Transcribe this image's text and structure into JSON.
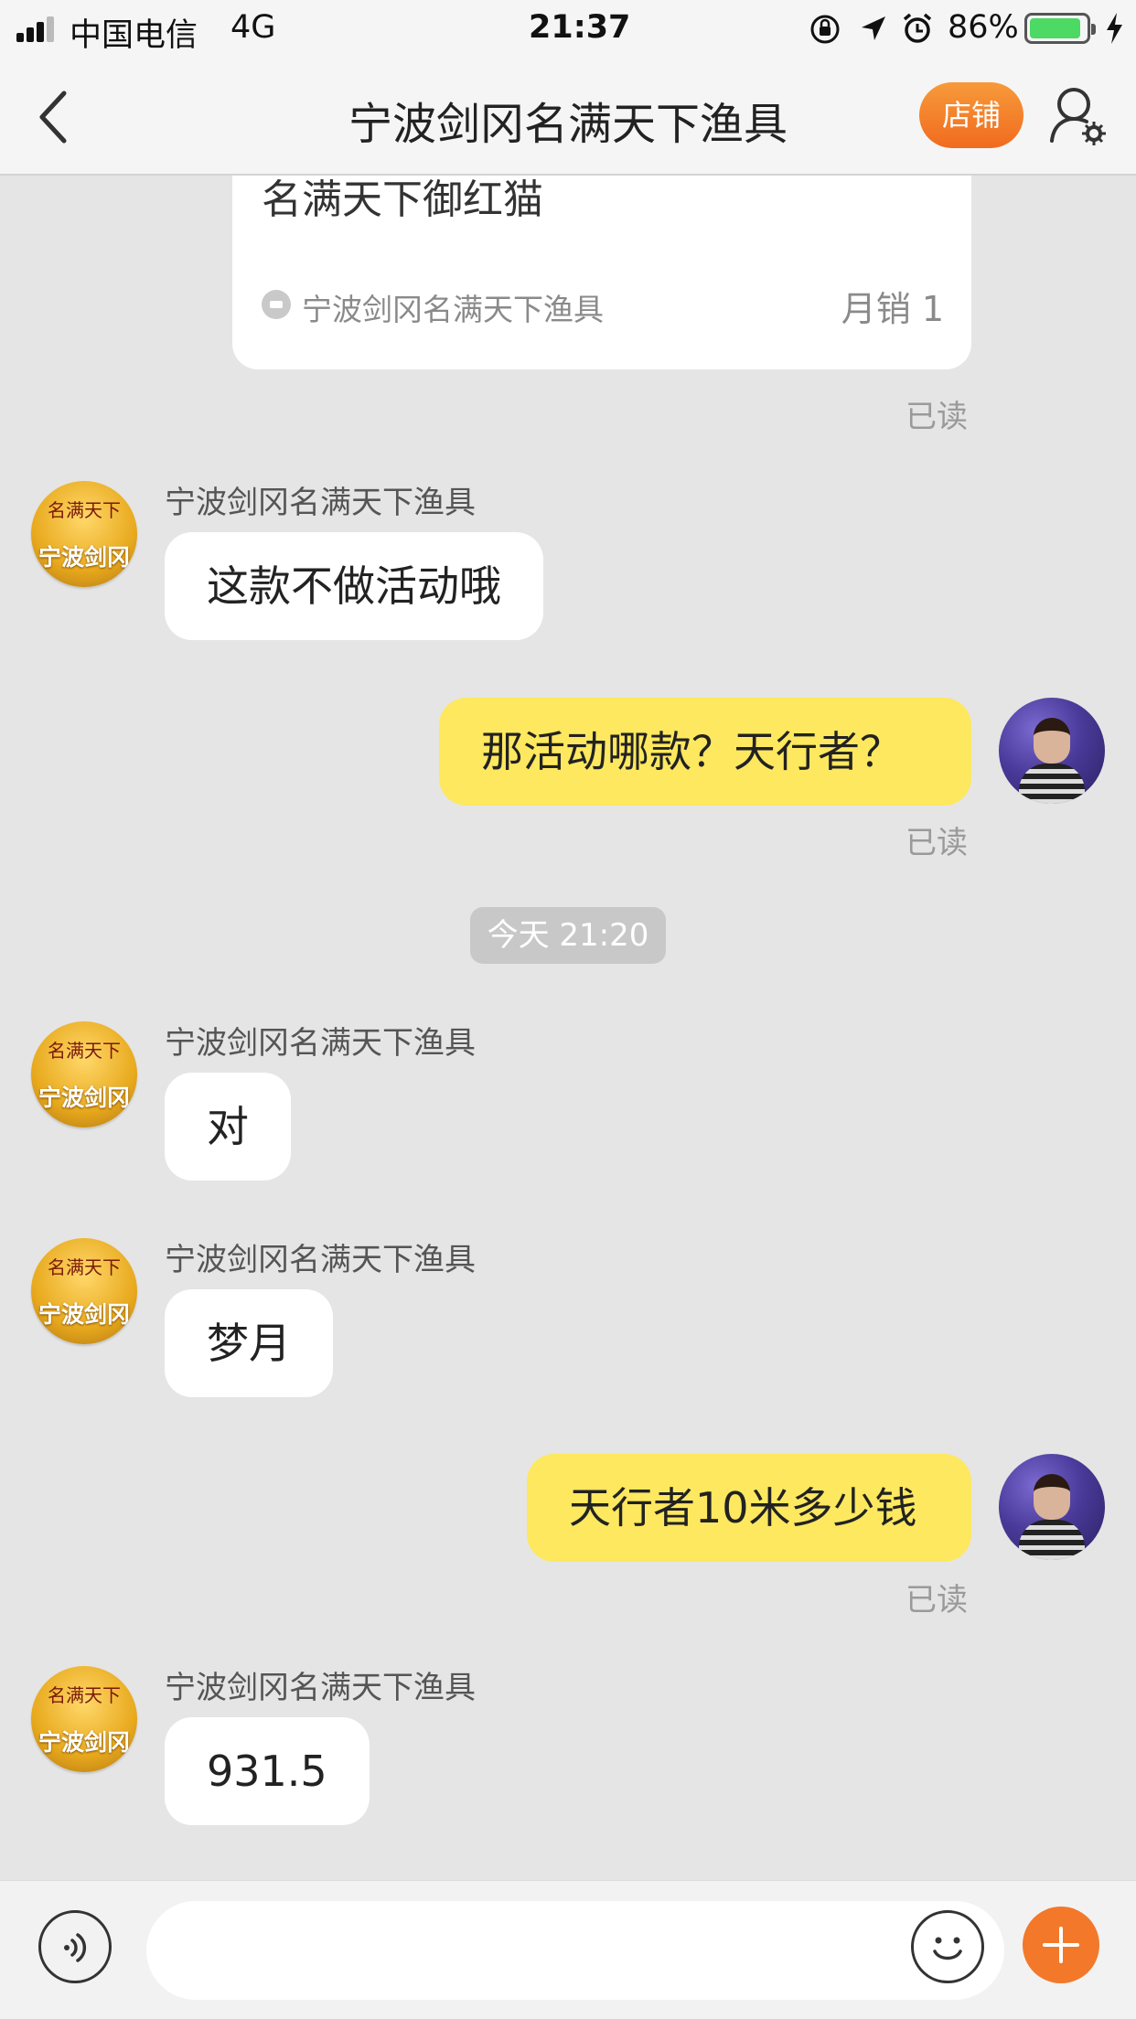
{
  "status_bar": {
    "carrier": "中国电信",
    "network": "4G",
    "time": "21:37",
    "battery_percent": "86%",
    "battery_level": 0.86,
    "icons": [
      "signal-icon",
      "rotation-lock-icon",
      "location-arrow-icon",
      "alarm-icon",
      "battery-icon",
      "charging-bolt-icon"
    ]
  },
  "nav": {
    "title": "宁波剑冈名满天下渔具",
    "shop_label": "店铺",
    "icons": [
      "back-chevron-icon",
      "user-settings-icon"
    ]
  },
  "product_card": {
    "name": "名满天下御红猫",
    "shop": "宁波剑冈名满天下渔具",
    "sales": "月销 1"
  },
  "shop_avatar_text": {
    "line1": "名满天下",
    "line2": "宁波剑冈"
  },
  "messages": [
    {
      "type": "read",
      "text": "已读"
    },
    {
      "type": "incoming",
      "sender": "宁波剑冈名满天下渔具",
      "text": "这款不做活动哦"
    },
    {
      "type": "outgoing",
      "text": "那活动哪款？天行者？",
      "status": "已读"
    },
    {
      "type": "time",
      "text": "今天 21:20"
    },
    {
      "type": "incoming",
      "sender": "宁波剑冈名满天下渔具",
      "text": "对"
    },
    {
      "type": "incoming",
      "sender": "宁波剑冈名满天下渔具",
      "text": "梦月"
    },
    {
      "type": "outgoing",
      "text": "天行者10米多少钱",
      "status": "已读"
    },
    {
      "type": "incoming",
      "sender": "宁波剑冈名满天下渔具",
      "text": "931.5"
    }
  ],
  "input_bar": {
    "placeholder": "",
    "icons": [
      "voice-icon",
      "emoji-icon",
      "plus-icon"
    ]
  },
  "colors": {
    "accent_orange": "#f3782a",
    "outgoing_bubble": "#fde85f",
    "incoming_bubble": "#ffffff",
    "chat_background": "#e5e5e5",
    "battery_green": "#4cd964"
  }
}
